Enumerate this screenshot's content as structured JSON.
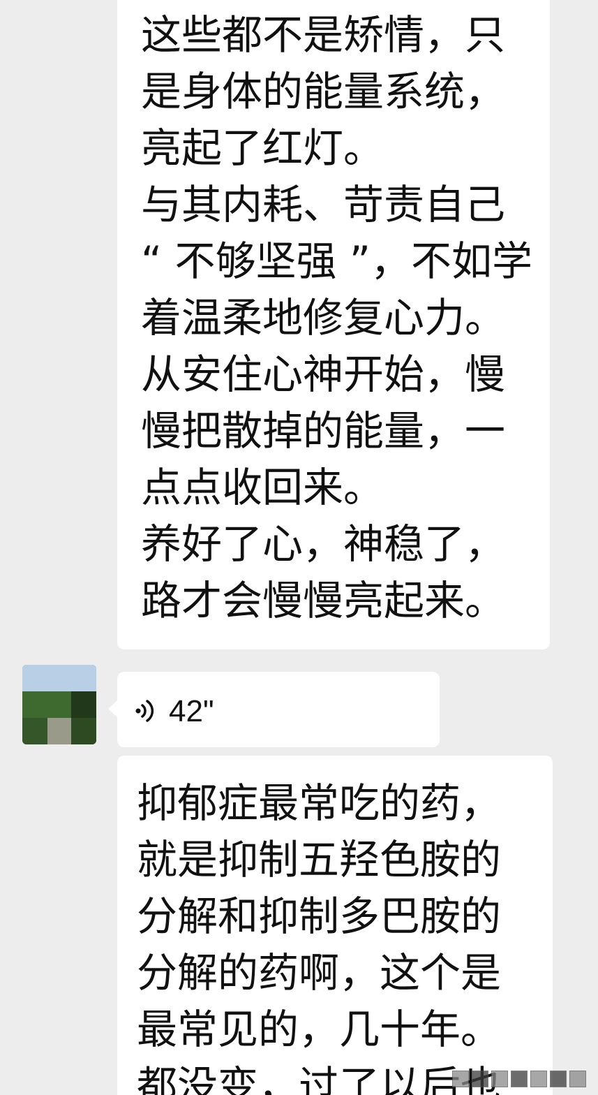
{
  "messages": [
    {
      "type": "text",
      "lines": [
        "这些都不是矫情，只",
        "是身体的能量系统，",
        "亮起了红灯。",
        "与其内耗、苛责自己",
        "“ 不够坚强 ”，不如学",
        "着温柔地修复心力。",
        "从安住心神开始，慢",
        "慢把散掉的能量，一",
        "点点收回来。",
        "养好了心，神稳了，",
        "路才会慢慢亮起来。"
      ]
    },
    {
      "type": "voice",
      "duration": "42\"",
      "icon": "voice-wave-icon"
    },
    {
      "type": "text",
      "lines": [
        "抑郁症最常吃的药，",
        "就是抑制五羟色胺的",
        "分解和抑制多巴胺的",
        "分解的药啊，这个是",
        "最常见的，几十年。",
        "都没变，过了以后也"
      ]
    }
  ],
  "colors": {
    "background": "#ededed",
    "bubble": "#ffffff",
    "text": "#111111"
  }
}
